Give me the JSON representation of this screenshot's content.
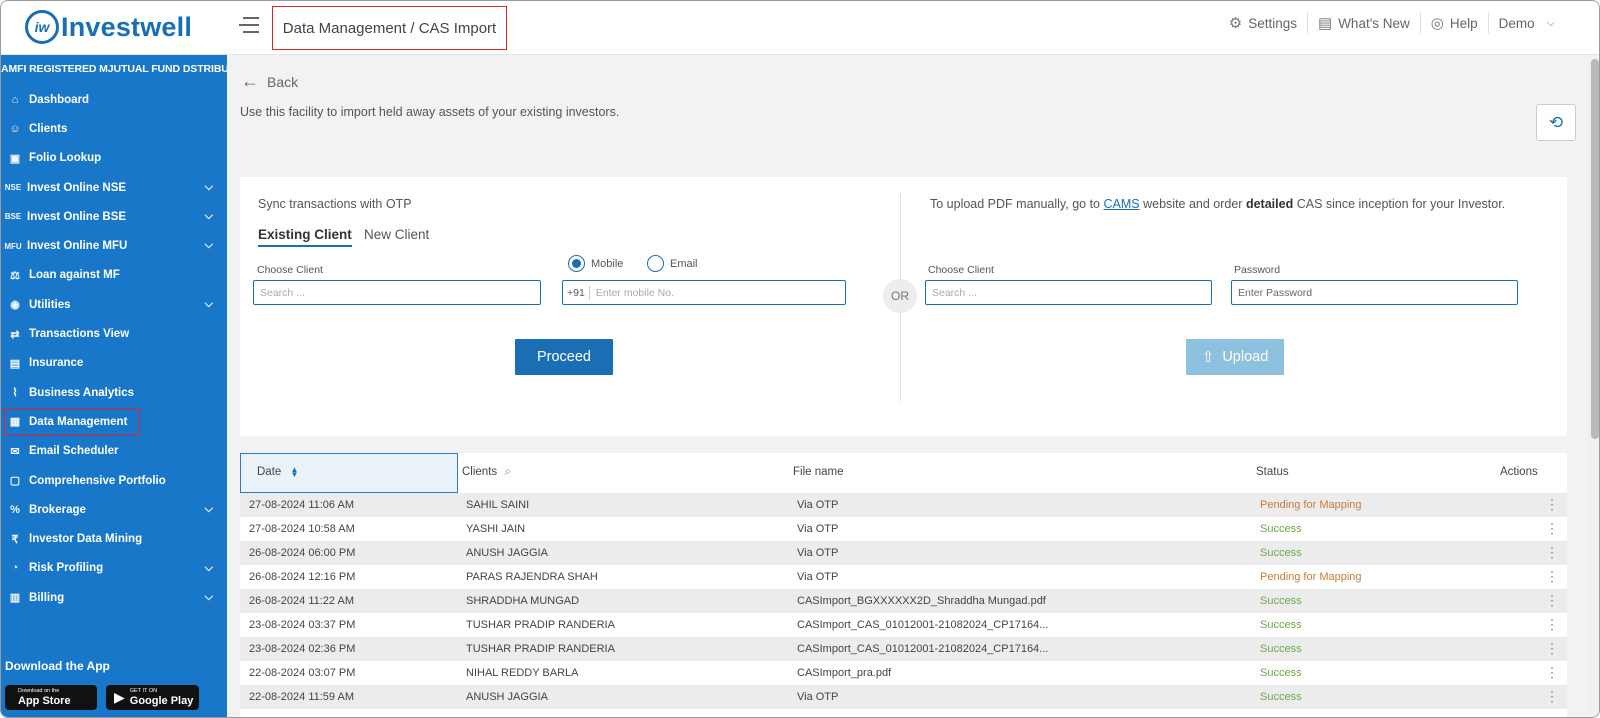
{
  "header": {
    "logo_text": "Investwell",
    "breadcrumb": "Data Management / CAS Import",
    "settings": "Settings",
    "whats_new": "What's New",
    "help": "Help",
    "user": "Demo"
  },
  "sidebar": {
    "tagline": "AMFI REGISTERED MJUTUAL FUND DSTRIBUTOR",
    "items": [
      {
        "label": "Dashboard",
        "icon": "home-icon",
        "caret": false
      },
      {
        "label": "Clients",
        "icon": "users-icon",
        "caret": false
      },
      {
        "label": "Folio Lookup",
        "icon": "folio-icon",
        "caret": false
      },
      {
        "label": "Invest Online NSE",
        "icon": "NSE",
        "caret": true
      },
      {
        "label": "Invest Online BSE",
        "icon": "BSE",
        "caret": true
      },
      {
        "label": "Invest Online MFU",
        "icon": "MFU",
        "caret": true
      },
      {
        "label": "Loan against MF",
        "icon": "loan-icon",
        "caret": false
      },
      {
        "label": "Utilities",
        "icon": "utilities-icon",
        "caret": true
      },
      {
        "label": "Transactions View",
        "icon": "transactions-icon",
        "caret": false
      },
      {
        "label": "Insurance",
        "icon": "insurance-icon",
        "caret": false
      },
      {
        "label": "Business Analytics",
        "icon": "analytics-icon",
        "caret": false
      },
      {
        "label": "Data Management",
        "icon": "data-icon",
        "caret": false
      },
      {
        "label": "Email Scheduler",
        "icon": "email-icon",
        "caret": false
      },
      {
        "label": "Comprehensive Portfolio",
        "icon": "portfolio-icon",
        "caret": false
      },
      {
        "label": "Brokerage",
        "icon": "brokerage-icon",
        "caret": true
      },
      {
        "label": "Investor Data Mining",
        "icon": "mining-icon",
        "caret": false
      },
      {
        "label": "Risk Profiling",
        "icon": "risk-icon",
        "caret": true
      },
      {
        "label": "Billing",
        "icon": "billing-icon",
        "caret": true
      }
    ],
    "download_title": "Download the App",
    "appstore_small": "Download on the",
    "appstore_big": "App Store",
    "gplay_small": "GET IT ON",
    "gplay_big": "Google Play"
  },
  "main": {
    "back": "Back",
    "description": "Use this facility to import held away assets of your existing investors.",
    "sync_title": "Sync transactions with OTP",
    "tab_existing": "Existing Client",
    "tab_new": "New Client",
    "choose_client_label": "Choose Client",
    "search_placeholder": "Search ...",
    "radio_mobile": "Mobile",
    "radio_email": "Email",
    "phone_prefix": "+91",
    "mobile_placeholder": "Enter mobile No.",
    "proceed": "Proceed",
    "or": "OR",
    "cams_text_1": "To upload PDF manually, go to",
    "cams_link": "CAMS",
    "cams_text_2": "website and order",
    "cams_bold": "detailed",
    "cams_text_3": "CAS since inception for your Investor.",
    "choose_client_label_2": "Choose Client",
    "search_placeholder_2": "Search ...",
    "password_label": "Password",
    "password_placeholder": "Enter Password",
    "upload": "Upload"
  },
  "table": {
    "headers": {
      "date": "Date",
      "clients": "Clients",
      "file": "File name",
      "status": "Status",
      "actions": "Actions"
    },
    "rows": [
      {
        "date": "27-08-2024 11:06 AM",
        "client": "SAHIL SAINI",
        "file": "Via OTP",
        "status": "Pending for Mapping",
        "kind": "pending"
      },
      {
        "date": "27-08-2024 10:58 AM",
        "client": "YASHI JAIN",
        "file": "Via OTP",
        "status": "Success",
        "kind": "success"
      },
      {
        "date": "26-08-2024 06:00 PM",
        "client": "ANUSH JAGGIA",
        "file": "Via OTP",
        "status": "Success",
        "kind": "success"
      },
      {
        "date": "26-08-2024 12:16 PM",
        "client": "PARAS RAJENDRA SHAH",
        "file": "Via OTP",
        "status": "Pending for Mapping",
        "kind": "pending"
      },
      {
        "date": "26-08-2024 11:22 AM",
        "client": "SHRADDHA MUNGAD",
        "file": "CASImport_BGXXXXXX2D_Shraddha Mungad.pdf",
        "status": "Success",
        "kind": "success"
      },
      {
        "date": "23-08-2024 03:37 PM",
        "client": "TUSHAR PRADIP RANDERIA",
        "file": "CASImport_CAS_01012001-21082024_CP17164...",
        "status": "Success",
        "kind": "success"
      },
      {
        "date": "23-08-2024 02:36 PM",
        "client": "TUSHAR PRADIP RANDERIA",
        "file": "CASImport_CAS_01012001-21082024_CP17164...",
        "status": "Success",
        "kind": "success"
      },
      {
        "date": "22-08-2024 03:07 PM",
        "client": "NIHAL REDDY BARLA",
        "file": "CASImport_pra.pdf",
        "status": "Success",
        "kind": "success"
      },
      {
        "date": "22-08-2024 11:59 AM",
        "client": "ANUSH JAGGIA",
        "file": "Via OTP",
        "status": "Success",
        "kind": "success"
      }
    ]
  },
  "colors": {
    "brand": "#1877c8",
    "accent": "#1a6fb4",
    "success": "#6aa84f",
    "pending": "#c97a3a",
    "highlight": "#d9262b"
  }
}
